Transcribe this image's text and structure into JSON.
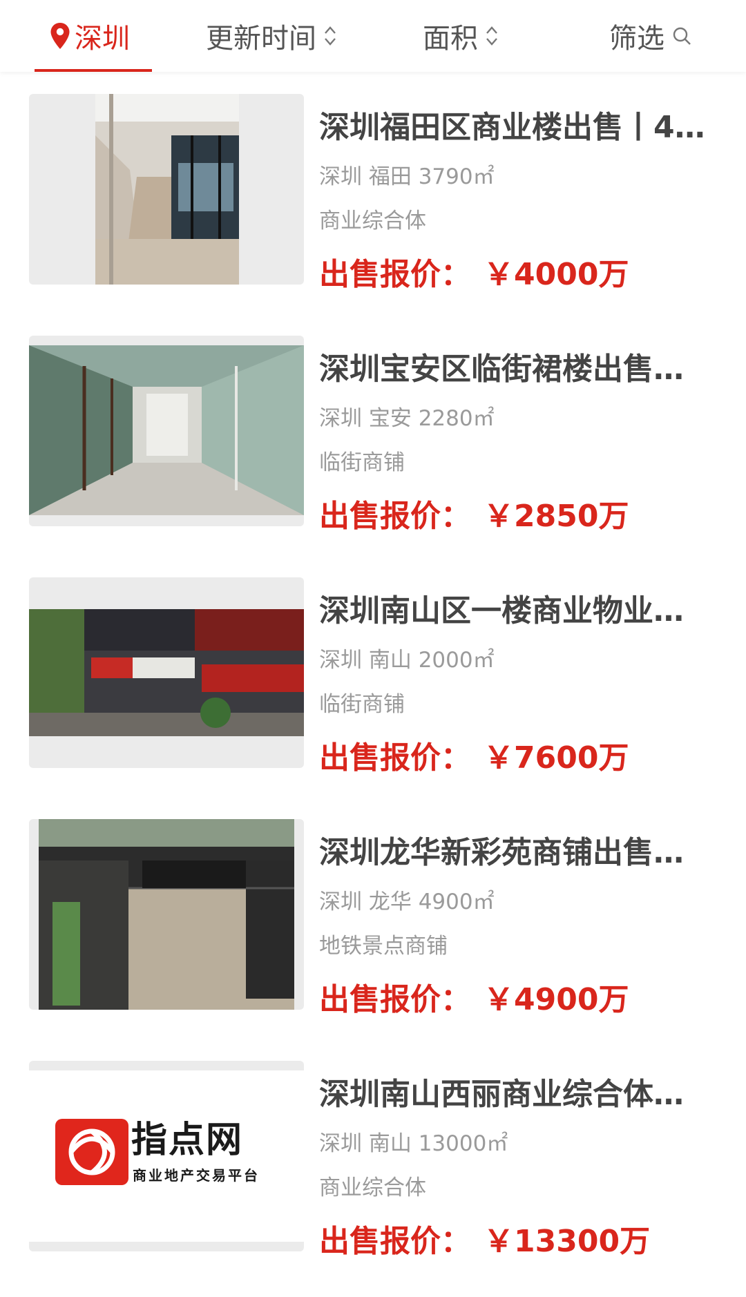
{
  "header": {
    "city": "深圳",
    "sort_time": "更新时间",
    "sort_area": "面积",
    "filter": "筛选"
  },
  "colors": {
    "accent": "#d9261c",
    "title": "#444444",
    "meta": "#9a9a9a"
  },
  "listings": [
    {
      "title": "深圳福田区商业楼出售丨4…",
      "location": "深圳 福田 3790㎡",
      "category": "商业综合体",
      "price_label": "出售报价：",
      "price": "￥4000万"
    },
    {
      "title": "深圳宝安区临街裙楼出售…",
      "location": "深圳 宝安 2280㎡",
      "category": "临街商铺",
      "price_label": "出售报价：",
      "price": "￥2850万"
    },
    {
      "title": "深圳南山区一楼商业物业…",
      "location": "深圳 南山 2000㎡",
      "category": "临街商铺",
      "price_label": "出售报价：",
      "price": "￥7600万"
    },
    {
      "title": "深圳龙华新彩苑商铺出售…",
      "location": "深圳 龙华 4900㎡",
      "category": "地铁景点商铺",
      "price_label": "出售报价：",
      "price": "￥4900万"
    },
    {
      "title": "深圳南山西丽商业综合体…",
      "location": "深圳 南山 13000㎡",
      "category": "商业综合体",
      "price_label": "出售报价：",
      "price": "￥13300万"
    }
  ],
  "logo": {
    "name": "指点网",
    "tagline": "商业地产交易平台"
  }
}
